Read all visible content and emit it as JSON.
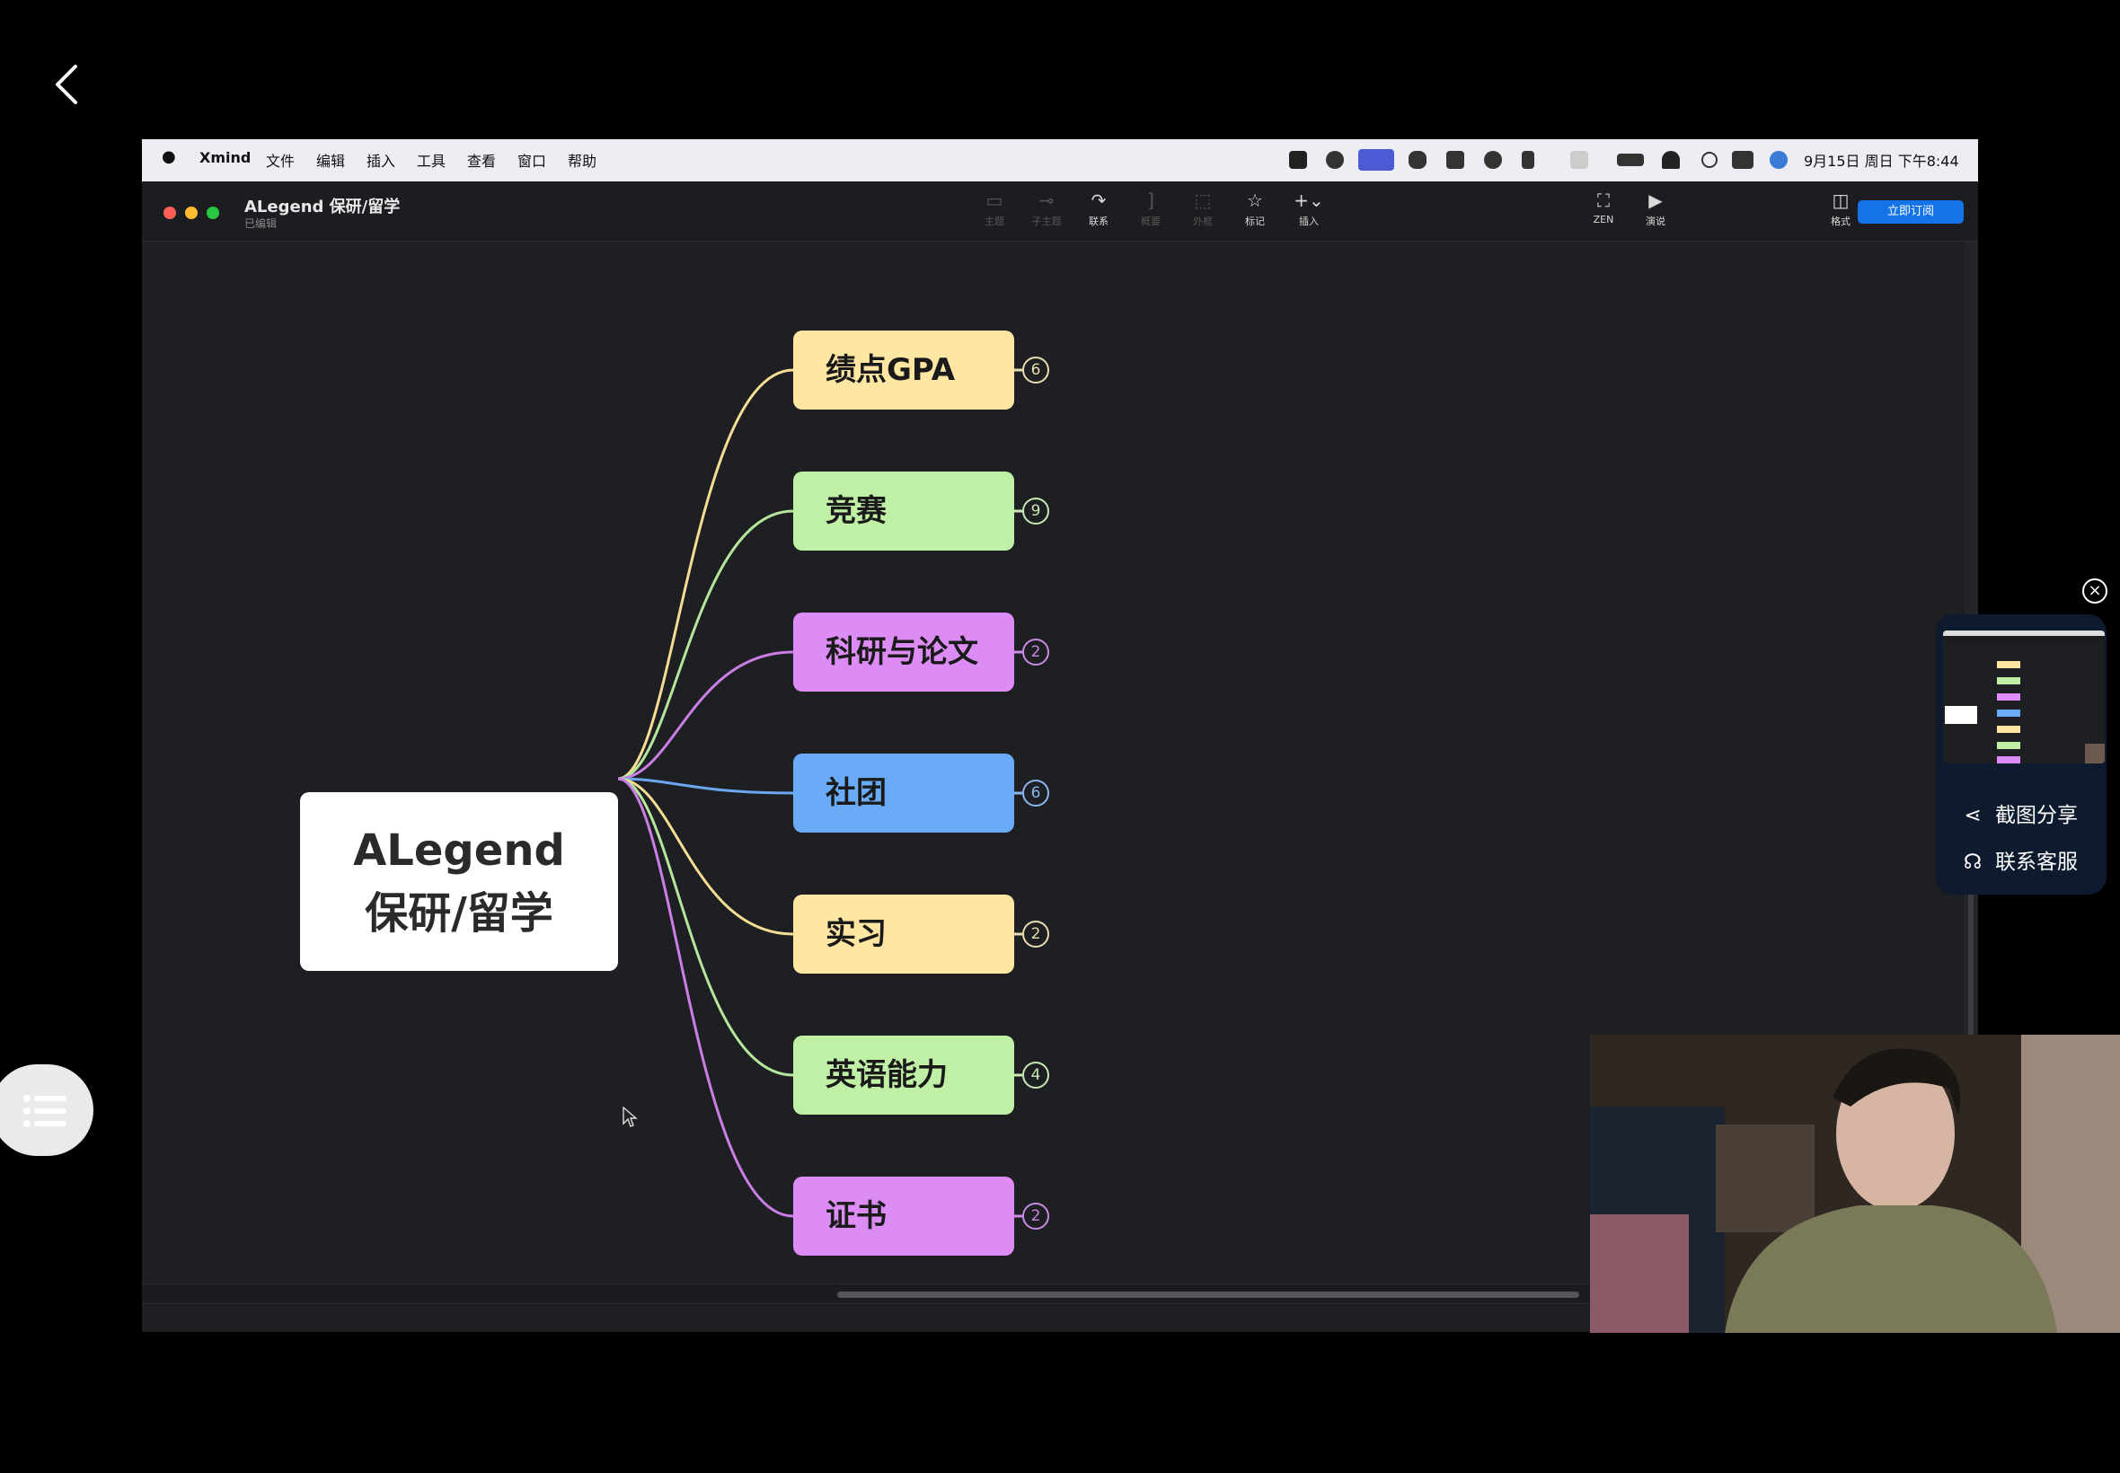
{
  "menubar": {
    "apple": "",
    "app": "Xmind",
    "menus": [
      "文件",
      "编辑",
      "插入",
      "工具",
      "查看",
      "窗口",
      "帮助"
    ],
    "clock": "9月15日 周日 下午8:44"
  },
  "document": {
    "title": "ALegend 保研/留学",
    "status": "已编辑"
  },
  "toolbar": {
    "tools": [
      {
        "label": "主题",
        "icon": "topic-icon",
        "state": "dim"
      },
      {
        "label": "子主题",
        "icon": "subtopic-icon",
        "state": "dim"
      },
      {
        "label": "联系",
        "icon": "relationship-icon",
        "state": "on"
      },
      {
        "label": "概要",
        "icon": "summary-icon",
        "state": "dim"
      },
      {
        "label": "外框",
        "icon": "boundary-icon",
        "state": "dim"
      },
      {
        "label": "标记",
        "icon": "marker-icon",
        "state": "on"
      },
      {
        "label": "插入",
        "icon": "insert-icon",
        "state": "on"
      }
    ],
    "zen": "ZEN",
    "present": "演说",
    "format": "格式",
    "subscribe": "立即订阅"
  },
  "mindmap": {
    "central_line1": "ALegend",
    "central_line2": "保研/留学",
    "branches": [
      {
        "label": "绩点GPA",
        "count": "6",
        "fill": "#ffe7a3",
        "stroke": "#f5dd93",
        "badge": "#e9dcb0"
      },
      {
        "label": "竞赛",
        "count": "9",
        "fill": "#bff0a6",
        "stroke": "#b4e79b",
        "badge": "#c9e8b4"
      },
      {
        "label": "科研与论文",
        "count": "2",
        "fill": "#dd8cf5",
        "stroke": "#cb7fe6",
        "badge": "#c98ae4"
      },
      {
        "label": "社团",
        "count": "6",
        "fill": "#6aabf7",
        "stroke": "#6aa7f0",
        "badge": "#8ab7ee"
      },
      {
        "label": "实习",
        "count": "2",
        "fill": "#ffe7a3",
        "stroke": "#f5dd93",
        "badge": "#e9dcb0"
      },
      {
        "label": "英语能力",
        "count": "4",
        "fill": "#bff0a6",
        "stroke": "#b4e79b",
        "badge": "#c9e8b4"
      },
      {
        "label": "证书",
        "count": "2",
        "fill": "#dd8cf5",
        "stroke": "#cb7fe6",
        "badge": "#c98ae4"
      }
    ]
  },
  "side_panel": {
    "share": "截图分享",
    "support": "联系客服"
  }
}
